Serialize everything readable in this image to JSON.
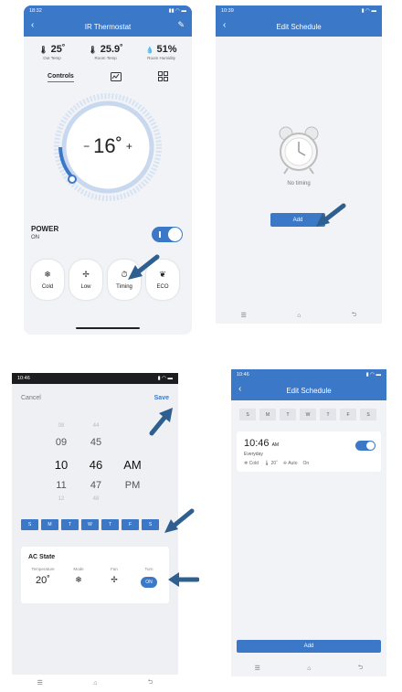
{
  "screen1": {
    "status_time": "18:32",
    "title": "IR Thermostat",
    "stats": [
      {
        "value": "25˚",
        "label": "Out Temp",
        "icon": "thermometer-icon"
      },
      {
        "value": "25.9˚",
        "label": "Room Temp",
        "icon": "thermometer-icon"
      },
      {
        "value": "51%",
        "label": "Room Humidity",
        "icon": "droplet-icon"
      }
    ],
    "tabs": {
      "controls": "Controls"
    },
    "dial": {
      "minus": "−",
      "temp": "16˚",
      "plus": "+"
    },
    "power": {
      "label": "POWER",
      "state": "ON"
    },
    "modes": [
      {
        "label": "Cold",
        "icon": "snowflake-icon"
      },
      {
        "label": "Low",
        "icon": "fan-icon"
      },
      {
        "label": "Timing",
        "icon": "timer-icon"
      },
      {
        "label": "ECO",
        "icon": "leaf-icon"
      }
    ]
  },
  "screen2": {
    "status_time": "10:39",
    "title": "Edit Schedule",
    "empty_text": "No timing",
    "add_label": "Add"
  },
  "screen3": {
    "status_time": "10:46",
    "cancel": "Cancel",
    "save": "Save",
    "picker": {
      "hours": [
        "08",
        "09",
        "10",
        "11",
        "12"
      ],
      "minutes": [
        "44",
        "45",
        "46",
        "47",
        "48"
      ],
      "ampm": [
        "AM",
        "PM"
      ]
    },
    "days": [
      "S",
      "M",
      "T",
      "W",
      "T",
      "F",
      "S"
    ],
    "ac_state": {
      "title": "AC State",
      "temperature_label": "Temperature",
      "temperature_value": "20˚",
      "mode_label": "Mode",
      "fan_label": "Fan",
      "turn_label": "Turn",
      "turn_value": "ON"
    }
  },
  "screen4": {
    "status_time": "10:46",
    "title": "Edit Schedule",
    "days": [
      "S",
      "M",
      "T",
      "W",
      "T",
      "F",
      "S"
    ],
    "schedule": {
      "time": "10:46",
      "ampm": "AM",
      "repeat": "Everyday",
      "mode": "Cold",
      "temp": "20˚",
      "fan": "Auto",
      "power": "On"
    },
    "add_label": "Add"
  },
  "colors": {
    "accent": "#3b78c7",
    "arrow": "#2f5f8f"
  }
}
